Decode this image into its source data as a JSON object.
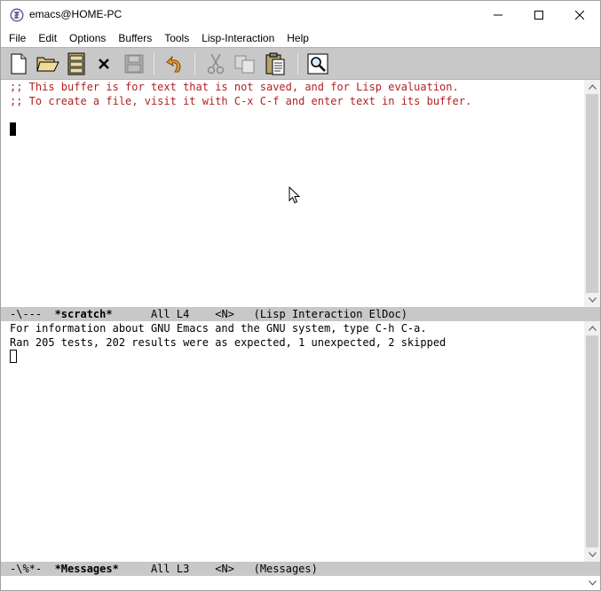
{
  "window": {
    "title": "emacs@HOME-PC",
    "app_icon": "emacs-icon",
    "controls": [
      "minimize-icon",
      "maximize-icon",
      "close-icon"
    ]
  },
  "menubar": {
    "items": [
      "File",
      "Edit",
      "Options",
      "Buffers",
      "Tools",
      "Lisp-Interaction",
      "Help"
    ]
  },
  "toolbar": {
    "buttons": [
      "new-file-icon",
      "open-folder-icon",
      "open-directory-icon",
      "close-buffer-icon",
      "save-icon",
      "undo-icon",
      "cut-icon",
      "copy-icon",
      "paste-icon",
      "search-icon"
    ]
  },
  "scratch": {
    "lines": [
      ";; This buffer is for text that is not saved, and for Lisp evaluation.",
      ";; To create a file, visit it with C-x C-f and enter text in its buffer."
    ]
  },
  "scratch_modeline": {
    "status": "-\\---",
    "buffer": "*scratch*",
    "position": "All L4",
    "narrow": "<N>",
    "mode": "(Lisp Interaction ElDoc)"
  },
  "messages": {
    "lines": [
      "For information about GNU Emacs and the GNU system, type C-h C-a.",
      "Ran 205 tests, 202 results were as expected, 1 unexpected, 2 skipped"
    ]
  },
  "messages_modeline": {
    "status": "-\\%*-",
    "buffer": "*Messages*",
    "position": "All L3",
    "narrow": "<N>",
    "mode": "(Messages)"
  },
  "colors": {
    "comment": "#b22222",
    "toolbar_bg": "#c8c8c8",
    "modeline_bg": "#c8c8c8"
  }
}
